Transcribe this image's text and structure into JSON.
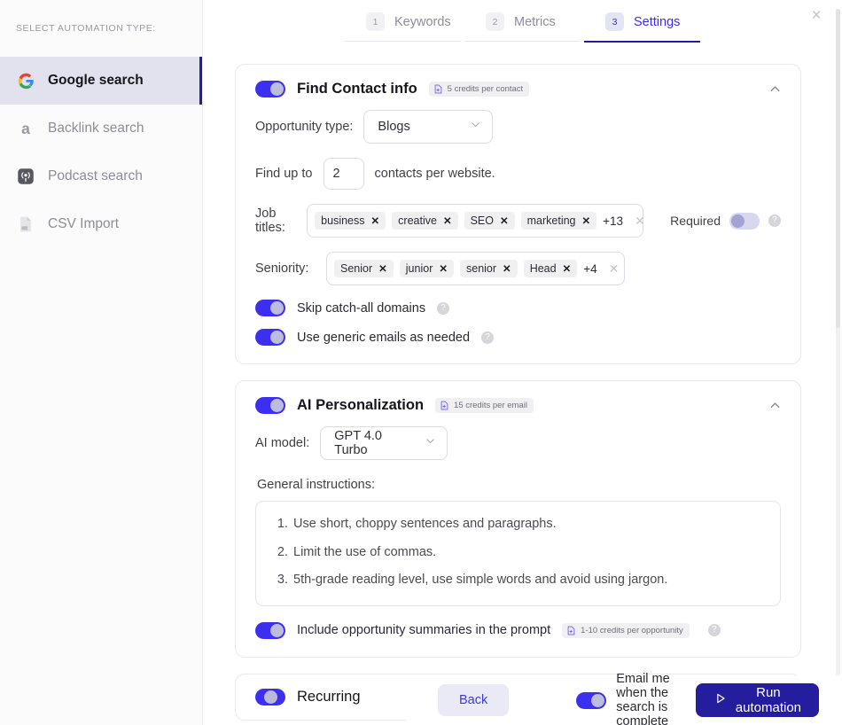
{
  "sidebar": {
    "caption": "SELECT AUTOMATION TYPE:",
    "items": [
      {
        "label": "Google search",
        "icon": "google-icon",
        "active": true
      },
      {
        "label": "Backlink search",
        "icon": "ahrefs-icon",
        "active": false
      },
      {
        "label": "Podcast search",
        "icon": "podcast-icon",
        "active": false
      },
      {
        "label": "CSV Import",
        "icon": "csv-file-icon",
        "active": false
      }
    ]
  },
  "stepper": {
    "steps": [
      {
        "num": "1",
        "label": "Keywords",
        "active": false
      },
      {
        "num": "2",
        "label": "Metrics",
        "active": false
      },
      {
        "num": "3",
        "label": "Settings",
        "active": true
      }
    ]
  },
  "close_label": "×",
  "contact_card": {
    "title": "Find Contact info",
    "badge": "5 credits per contact",
    "toggle_state": "on",
    "opportunity_type_label": "Opportunity type:",
    "opportunity_type_value": "Blogs",
    "find_up_to_label": "Find up to",
    "find_up_to_value": "2",
    "contacts_suffix": "contacts per website.",
    "job_titles_label": "Job titles:",
    "job_titles": [
      "business",
      "creative",
      "SEO",
      "marketing"
    ],
    "job_titles_more": "+13",
    "required_label": "Required",
    "required_state": "off",
    "seniority_label": "Seniority:",
    "seniority": [
      "Senior",
      "junior",
      "senior",
      "Head"
    ],
    "seniority_more": "+4",
    "options": [
      {
        "label": "Skip catch-all domains",
        "state": "on",
        "help": true
      },
      {
        "label": "Use generic emails as needed",
        "state": "on",
        "help": true
      }
    ]
  },
  "ai_card": {
    "title": "AI Personalization",
    "badge": "15 credits per email",
    "toggle_state": "on",
    "model_label": "AI model:",
    "model_value": "GPT 4.0 Turbo",
    "instructions_label": "General instructions:",
    "instructions": [
      "Use short, choppy sentences and paragraphs.",
      "Limit the use of commas.",
      "5th-grade reading level, use simple words and avoid using jargon."
    ],
    "summaries_label": "Include opportunity summaries in the prompt",
    "summaries_badge": "1-10 credits per opportunity",
    "summaries_state": "on"
  },
  "recurring_card": {
    "title": "Recurring",
    "toggle_state": "mid"
  },
  "bottombar": {
    "back_label": "Back",
    "email_label": "Email me when the search is complete",
    "email_state": "on",
    "run_label": "Run automation"
  },
  "colors": {
    "accent": "#3c2ff0",
    "accent_dark": "#241e9e",
    "sidebar_active_bg": "#e2e2ef",
    "tag_bg": "#f0f0f0"
  }
}
